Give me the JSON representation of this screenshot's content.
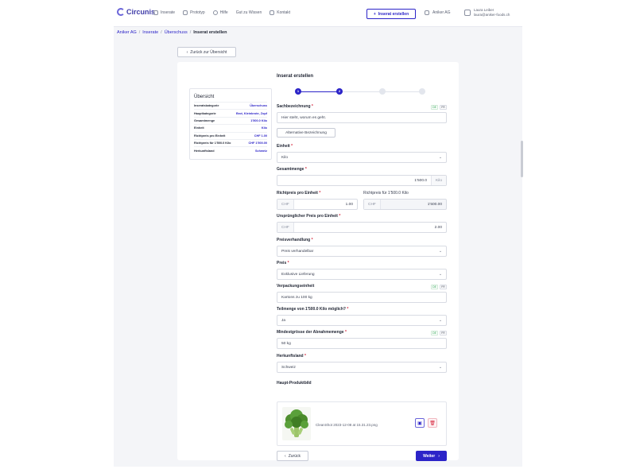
{
  "brand": {
    "name": "Circunis",
    "accent": "#2c24c8"
  },
  "nav": {
    "items": [
      {
        "label": "Inserate",
        "icon": "compass-icon"
      },
      {
        "label": "Prototyp",
        "icon": "flask-icon"
      },
      {
        "label": "Hilfe",
        "icon": "help-icon"
      },
      {
        "label": "Gut zu Wissen",
        "icon": "book-icon"
      },
      {
        "label": "Kontakt",
        "icon": "mail-icon"
      }
    ],
    "cta_label": "Inserat erstellen",
    "company": "Aniker AG",
    "user_name": "Laura Leiber",
    "user_email": "laura@aniker-foods.ch"
  },
  "breadcrumb": [
    "Aniker AG",
    "Inserate",
    "Überschuss",
    "Inserat erstellen"
  ],
  "back_to_overview": "Zurück zur Übersicht",
  "summary": {
    "title": "Übersicht",
    "rows": [
      {
        "k": "Inseratskategorie",
        "v": "Überschuss"
      },
      {
        "k": "Hauptkategorie",
        "v": "Brot, Kleinbrote, Zopf"
      },
      {
        "k": "Gesamtmenge",
        "v": "1'500.0 Kilo"
      },
      {
        "k": "Einheit",
        "v": "Kilo"
      },
      {
        "k": "Richtpreis pro Einheit",
        "v": "CHF 1.00"
      },
      {
        "k": "Richtpreis für 1'500.0 Kilo",
        "v": "CHF 1'500.00"
      },
      {
        "k": "Herkunftsland",
        "v": "Schweiz"
      }
    ]
  },
  "form": {
    "title": "Inserat erstellen",
    "steps": [
      {
        "label": "1",
        "done": true
      },
      {
        "label": "2",
        "done": true
      },
      {
        "label": "",
        "done": false
      },
      {
        "label": "",
        "done": false
      }
    ],
    "lang_de": "DE",
    "lang_fr": "FR",
    "sachbezeichnung": {
      "label": "Sachbezeichnung",
      "value": "Hier steht, worum es geht."
    },
    "alt_label": "Alternative Bezeichnung",
    "einheit": {
      "label": "Einheit",
      "value": "Kilo"
    },
    "gesamtmenge": {
      "label": "Gesamtmenge",
      "value": "1'500.0",
      "unit": "Kilo"
    },
    "richtpreis_einheit": {
      "label": "Richtpreis pro Einheit",
      "currency": "CHF",
      "value": "1.00"
    },
    "richtpreis_total": {
      "label": "Richtpreis für 1'500.0 Kilo",
      "currency": "CHF",
      "value": "1'500.00"
    },
    "ursprungspreis": {
      "label": "Ursprünglicher Preis pro Einheit",
      "currency": "CHF",
      "value": "2.00"
    },
    "preisverhandlung": {
      "label": "Preisverhandlung",
      "value": "Preis verhandelbar"
    },
    "preis": {
      "label": "Preis",
      "value": "Exklusive Lieferung"
    },
    "verpackung": {
      "label": "Verpackungseinheit",
      "value": "Kartons zu 100 kg"
    },
    "teilmenge": {
      "label": "Teilmenge von 1'500.0 Kilo möglich?",
      "value": "Ja"
    },
    "mindestgroesse": {
      "label": "Mindestgrösse der Abnahmemenge",
      "value": "50 kg"
    },
    "herkunftsland": {
      "label": "Herkunftsland",
      "value": "Schweiz"
    },
    "bild": {
      "label": "Haupt-Produktbild",
      "filename": "CleanShot 2023-12-08 at 15.31.23.png"
    },
    "back_label": "Zurück",
    "next_label": "Weiter"
  }
}
